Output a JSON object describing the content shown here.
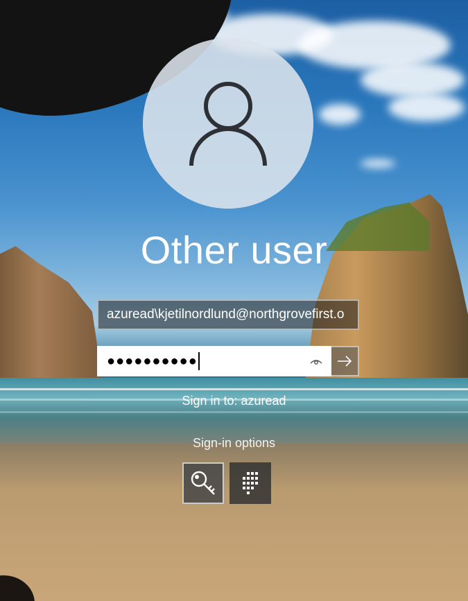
{
  "login": {
    "title": "Other user",
    "username_value": "azuread\\kjetilnordlund@northgrovefirst.o",
    "password_mask": "●●●●●●●●●●",
    "sign_in_to": "Sign in to: azuread",
    "sign_in_options": "Sign-in options"
  },
  "icons": {
    "avatar": "user-icon",
    "reveal": "eye-icon",
    "submit": "arrow-right-icon",
    "options": [
      "key-icon",
      "pin-keypad-icon"
    ]
  },
  "colors": {
    "text": "#ffffff",
    "field_bg": "#ffffff",
    "avatar_bg": "#dce4ec"
  }
}
